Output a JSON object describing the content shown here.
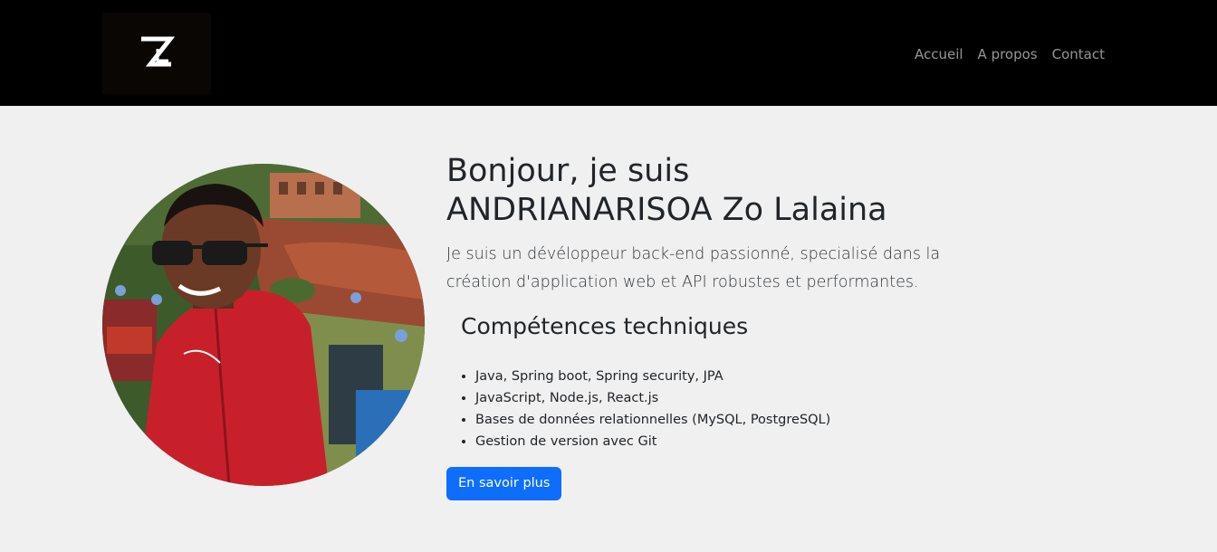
{
  "brand": {
    "logo_text": "Z",
    "icon": "zl-monogram-logo"
  },
  "nav": {
    "items": [
      {
        "label": "Accueil"
      },
      {
        "label": "A propos"
      },
      {
        "label": "Contact"
      }
    ]
  },
  "hero": {
    "photo_alt": "Photo de ANDRIANARISOA Zo Lalaina",
    "title_line1": "Bonjour, je suis",
    "title_line2": "ANDRIANARISOA Zo Lalaina",
    "lead": "Je suis un dévéloppeur back-end passionné, specialisé dans la création d'application web et API robustes et performantes.",
    "skills_title": "Compétences techniques",
    "skills": [
      "Java, Spring boot, Spring security, JPA",
      "JavaScript, Node.js, React.js",
      "Bases de données relationnelles (MySQL, PostgreSQL)",
      "Gestion de version avec Git"
    ],
    "cta_label": "En savoir plus"
  },
  "colors": {
    "navbar_bg": "#000000",
    "page_bg": "#f0f0f0",
    "primary_button": "#0d6efd",
    "nav_link": "#8c8c8c"
  }
}
